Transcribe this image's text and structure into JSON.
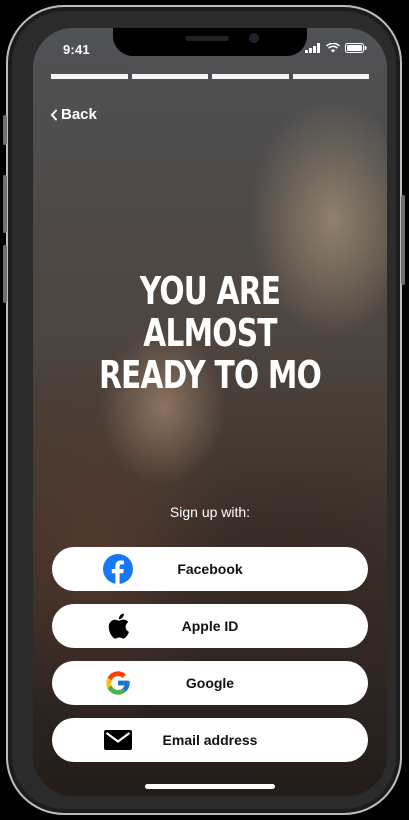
{
  "status_bar": {
    "time": "9:41",
    "icons": [
      "signal-icon",
      "wifi-icon",
      "battery-icon"
    ]
  },
  "progress": {
    "total_steps": 4,
    "completed_steps": 4
  },
  "nav": {
    "back_label": "Back",
    "back_icon": "chevron-left-icon"
  },
  "hero": {
    "headline_line1": "YOU ARE ALMOST",
    "headline_line2": "READY TO MO"
  },
  "signup": {
    "label": "Sign up with:",
    "options": [
      {
        "label": "Facebook",
        "icon": "facebook-icon",
        "color": "#1877F2"
      },
      {
        "label": "Apple ID",
        "icon": "apple-icon",
        "color": "#000000"
      },
      {
        "label": "Google",
        "icon": "google-icon",
        "color": "#4285F4"
      },
      {
        "label": "Email address",
        "icon": "envelope-icon",
        "color": "#000000"
      }
    ]
  }
}
